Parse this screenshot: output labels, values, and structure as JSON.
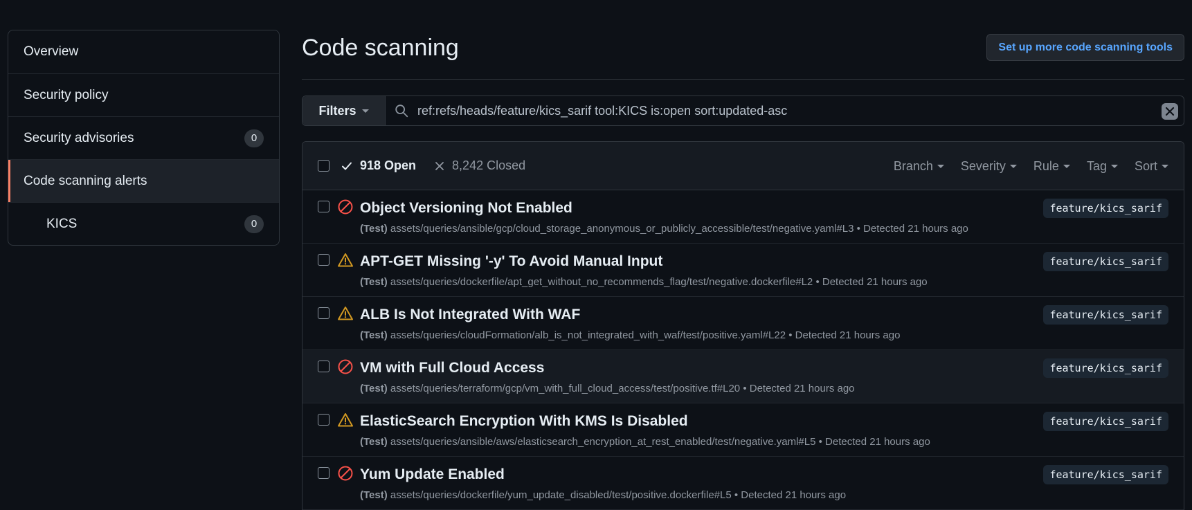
{
  "sidebar": {
    "items": [
      {
        "label": "Overview"
      },
      {
        "label": "Security policy"
      },
      {
        "label": "Security advisories",
        "count": "0"
      },
      {
        "label": "Code scanning alerts"
      },
      {
        "label": "KICS",
        "count": "0"
      }
    ]
  },
  "header": {
    "title": "Code scanning",
    "setup_button": "Set up more code scanning tools"
  },
  "filterbar": {
    "filters_label": "Filters",
    "query": "ref:refs/heads/feature/kics_sarif tool:KICS is:open sort:updated-asc"
  },
  "results": {
    "open_label": "918 Open",
    "closed_label": "8,242 Closed",
    "filters": [
      "Branch",
      "Severity",
      "Rule",
      "Tag",
      "Sort"
    ],
    "alerts": [
      {
        "severity": "error",
        "title": "Object Versioning Not Enabled",
        "tag": "(Test)",
        "path": "assets/queries/ansible/gcp/cloud_storage_anonymous_or_publicly_accessible/test/negative.yaml#L3",
        "detected": "• Detected 21 hours ago",
        "branch": "feature/kics_sarif"
      },
      {
        "severity": "warning",
        "title": "APT-GET Missing '-y' To Avoid Manual Input",
        "tag": "(Test)",
        "path": "assets/queries/dockerfile/apt_get_without_no_recommends_flag/test/negative.dockerfile#L2",
        "detected": "• Detected 21 hours ago",
        "branch": "feature/kics_sarif"
      },
      {
        "severity": "warning",
        "title": "ALB Is Not Integrated With WAF",
        "tag": "(Test)",
        "path": "assets/queries/cloudFormation/alb_is_not_integrated_with_waf/test/positive.yaml#L22",
        "detected": "• Detected 21 hours ago",
        "branch": "feature/kics_sarif"
      },
      {
        "severity": "error",
        "title": "VM with Full Cloud Access",
        "tag": "(Test)",
        "path": "assets/queries/terraform/gcp/vm_with_full_cloud_access/test/positive.tf#L20",
        "detected": "• Detected 21 hours ago",
        "branch": "feature/kics_sarif"
      },
      {
        "severity": "warning",
        "title": "ElasticSearch Encryption With KMS Is Disabled",
        "tag": "(Test)",
        "path": "assets/queries/ansible/aws/elasticsearch_encryption_at_rest_enabled/test/negative.yaml#L5",
        "detected": "• Detected 21 hours ago",
        "branch": "feature/kics_sarif"
      },
      {
        "severity": "error",
        "title": "Yum Update Enabled",
        "tag": "(Test)",
        "path": "assets/queries/dockerfile/yum_update_disabled/test/positive.dockerfile#L5",
        "detected": "• Detected 21 hours ago",
        "branch": "feature/kics_sarif"
      }
    ]
  },
  "colors": {
    "error": "#f85149",
    "warning": "#d29922",
    "link": "#58a6ff",
    "active_marker": "#f78166"
  }
}
